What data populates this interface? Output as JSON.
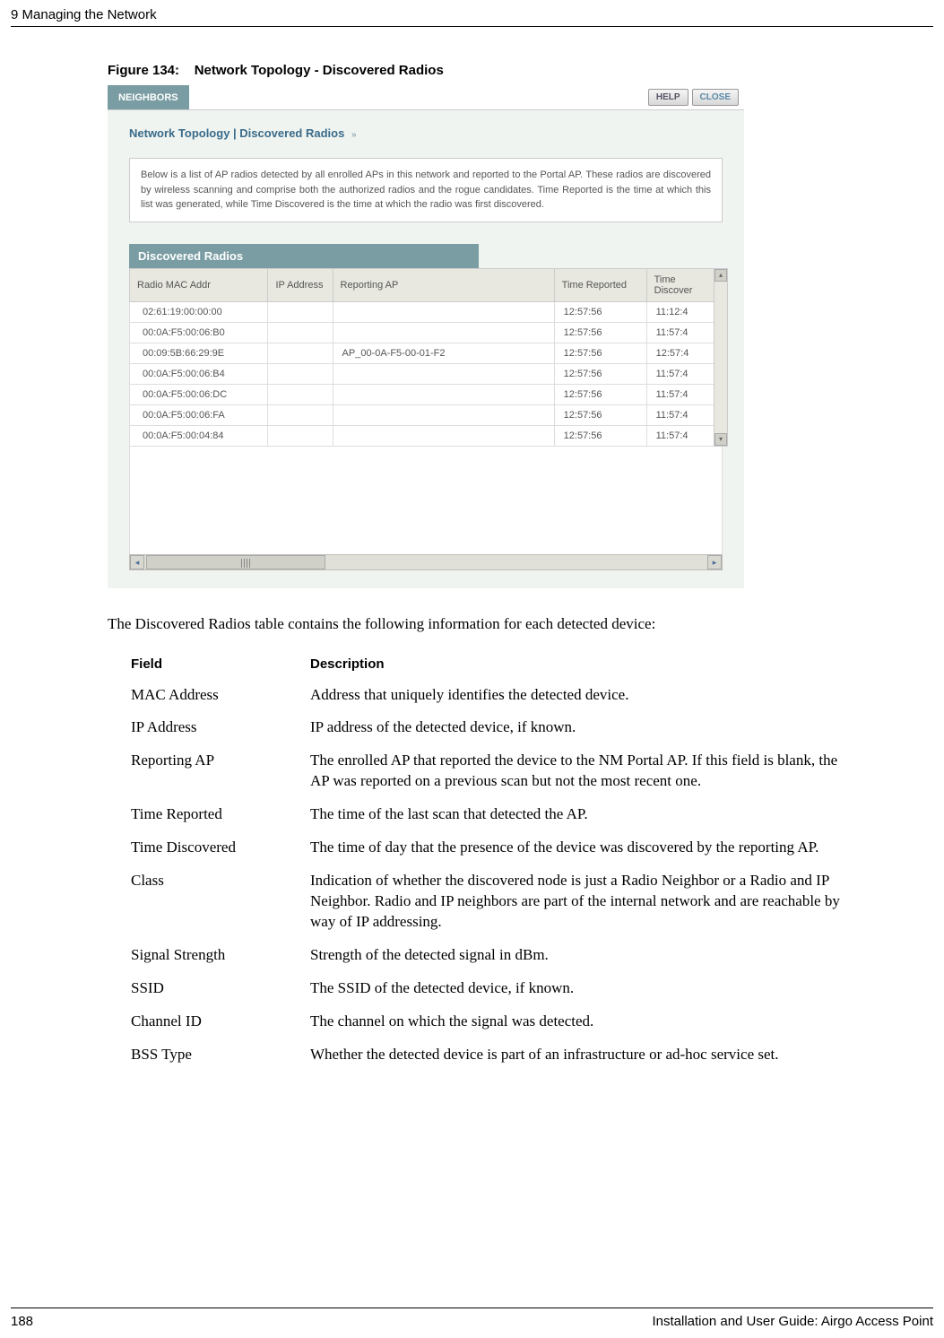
{
  "header": {
    "chapter": "9  Managing the Network"
  },
  "figure": {
    "label": "Figure 134:",
    "title": "Network Topology - Discovered Radios"
  },
  "app": {
    "tab": "NEIGHBORS",
    "help_btn": "HELP",
    "close_btn": "CLOSE",
    "breadcrumb": "Network Topology | Discovered Radios",
    "info": "Below is a list of AP radios detected by all enrolled APs in this network and reported to the Portal AP. These radios are discovered by wireless scanning and comprise both the authorized radios and the rogue candidates. Time Reported is the time at which this list was generated, while Time Discovered is the time at which the radio was first discovered.",
    "section_title": "Discovered Radios",
    "columns": {
      "mac": "Radio MAC Addr",
      "ip": "IP Address",
      "ap": "Reporting AP",
      "tr": "Time Reported",
      "td": "Time Discover"
    },
    "rows": [
      {
        "mac": "02:61:19:00:00:00",
        "ip": "",
        "ap": "",
        "tr": "12:57:56",
        "td": "11:12:4"
      },
      {
        "mac": "00:0A:F5:00:06:B0",
        "ip": "",
        "ap": "",
        "tr": "12:57:56",
        "td": "11:57:4"
      },
      {
        "mac": "00:09:5B:66:29:9E",
        "ip": "",
        "ap": "AP_00-0A-F5-00-01-F2",
        "tr": "12:57:56",
        "td": "12:57:4"
      },
      {
        "mac": "00:0A:F5:00:06:B4",
        "ip": "",
        "ap": "",
        "tr": "12:57:56",
        "td": "11:57:4"
      },
      {
        "mac": "00:0A:F5:00:06:DC",
        "ip": "",
        "ap": "",
        "tr": "12:57:56",
        "td": "11:57:4"
      },
      {
        "mac": "00:0A:F5:00:06:FA",
        "ip": "",
        "ap": "",
        "tr": "12:57:56",
        "td": "11:57:4"
      },
      {
        "mac": "00:0A:F5:00:04:84",
        "ip": "",
        "ap": "",
        "tr": "12:57:56",
        "td": "11:57:4"
      }
    ]
  },
  "body": {
    "intro": "The Discovered Radios table contains the following information for each detected device:"
  },
  "fields": {
    "header_field": "Field",
    "header_desc": "Description",
    "rows": [
      {
        "name": "MAC Address",
        "desc": "Address that uniquely identifies the detected device."
      },
      {
        "name": "IP Address",
        "desc": "IP address of the detected device, if known."
      },
      {
        "name": "Reporting AP",
        "desc": "The enrolled AP that reported the device to the NM Portal AP. If this field is blank, the AP was reported on a previous scan but not the most recent one."
      },
      {
        "name": "Time Reported",
        "desc": "The time of the last scan that detected the AP."
      },
      {
        "name": "Time Discovered",
        "desc": "The time of day that the presence of the device was discovered by the reporting AP."
      },
      {
        "name": "Class",
        "desc": "Indication of whether the discovered node is just a Radio Neighbor or a Radio and IP Neighbor. Radio and IP neighbors are part of the internal network and are reachable by way of IP addressing."
      },
      {
        "name": "Signal Strength",
        "desc": "Strength of the detected signal in dBm."
      },
      {
        "name": "SSID",
        "desc": "The SSID of the detected device, if known."
      },
      {
        "name": "Channel ID",
        "desc": "The channel on which the signal was detected."
      },
      {
        "name": "BSS Type",
        "desc": "Whether the detected device is part of an infrastructure or ad-hoc service set."
      }
    ]
  },
  "footer": {
    "page": "188",
    "doc": "Installation and User Guide: Airgo Access Point"
  }
}
